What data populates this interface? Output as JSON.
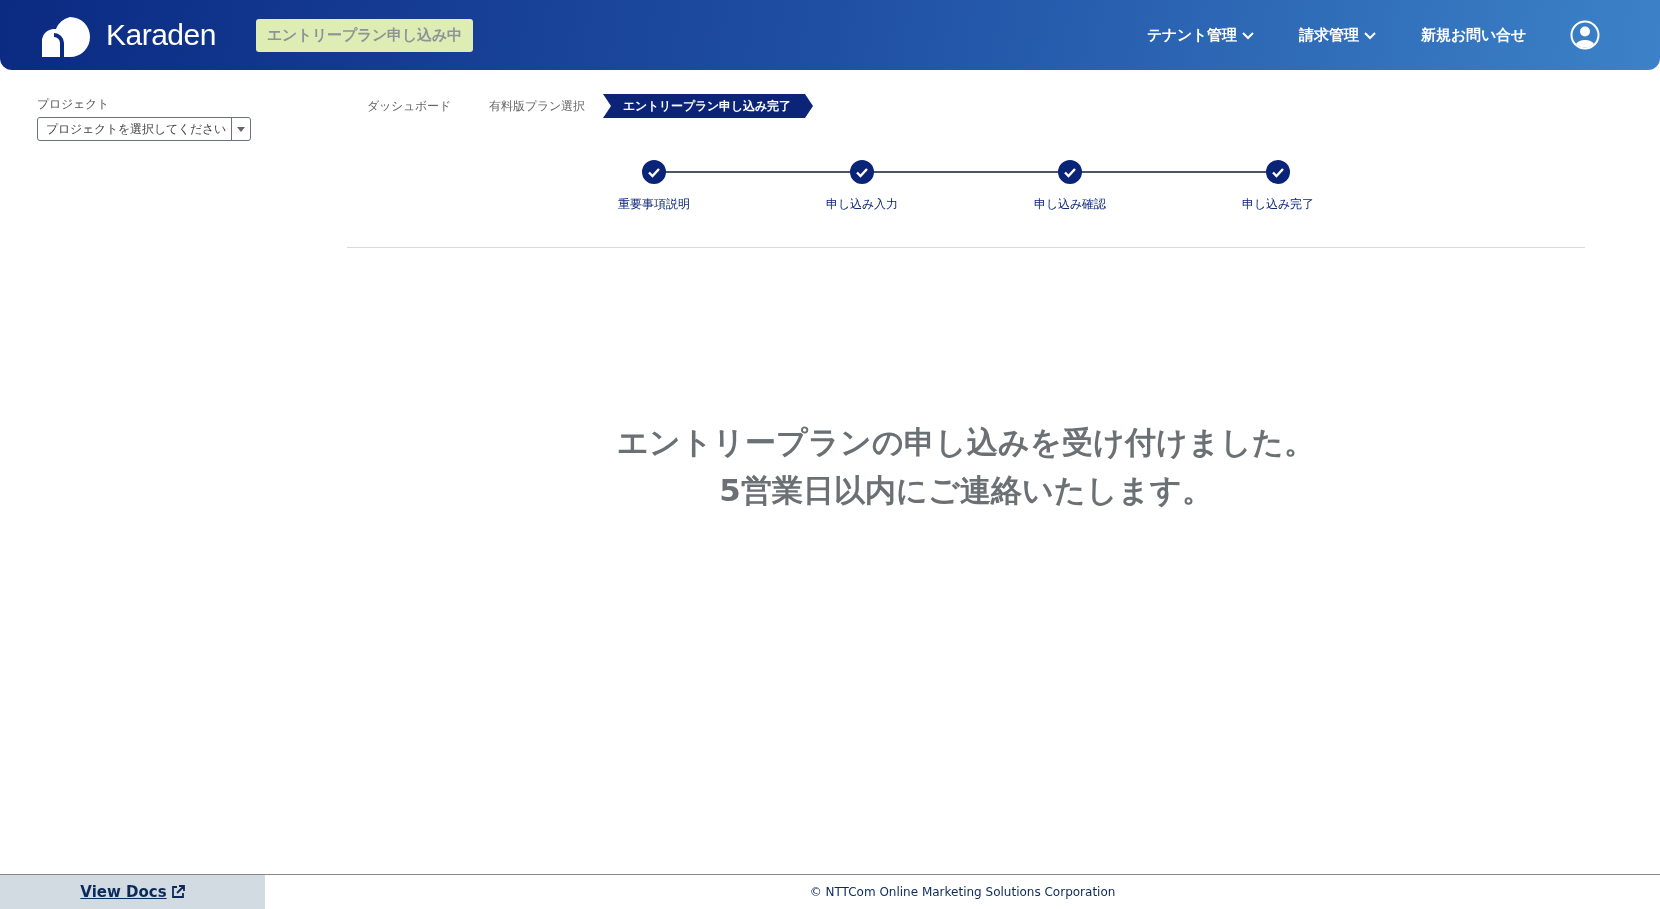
{
  "header": {
    "logo": "Karaden",
    "plan_badge": "エントリープラン申し込み中",
    "nav": [
      {
        "label": "テナント管理",
        "dropdown": true
      },
      {
        "label": "請求管理",
        "dropdown": true
      },
      {
        "label": "新規お問い合せ",
        "dropdown": false
      }
    ]
  },
  "sidebar": {
    "project_label": "プロジェクト",
    "project_select": {
      "placeholder": "プロジェクトを選択してください"
    }
  },
  "breadcrumb": [
    {
      "label": "ダッシュボード",
      "selected": false
    },
    {
      "label": "有料版プラン選択",
      "selected": false
    },
    {
      "label": "エントリープラン申し込み完了",
      "selected": true
    }
  ],
  "steps": [
    {
      "label": "重要事項説明",
      "done": true
    },
    {
      "label": "申し込み入力",
      "done": true
    },
    {
      "label": "申し込み確認",
      "done": true
    },
    {
      "label": "申し込み完了",
      "done": true
    }
  ],
  "message": [
    "エントリープランの申し込みを受け付けました。",
    "5営業日以内にご連絡いたします。"
  ],
  "footer": {
    "docs_link": "View Docs",
    "copyright": "© NTTCom Online Marketing Solutions Corporation"
  }
}
